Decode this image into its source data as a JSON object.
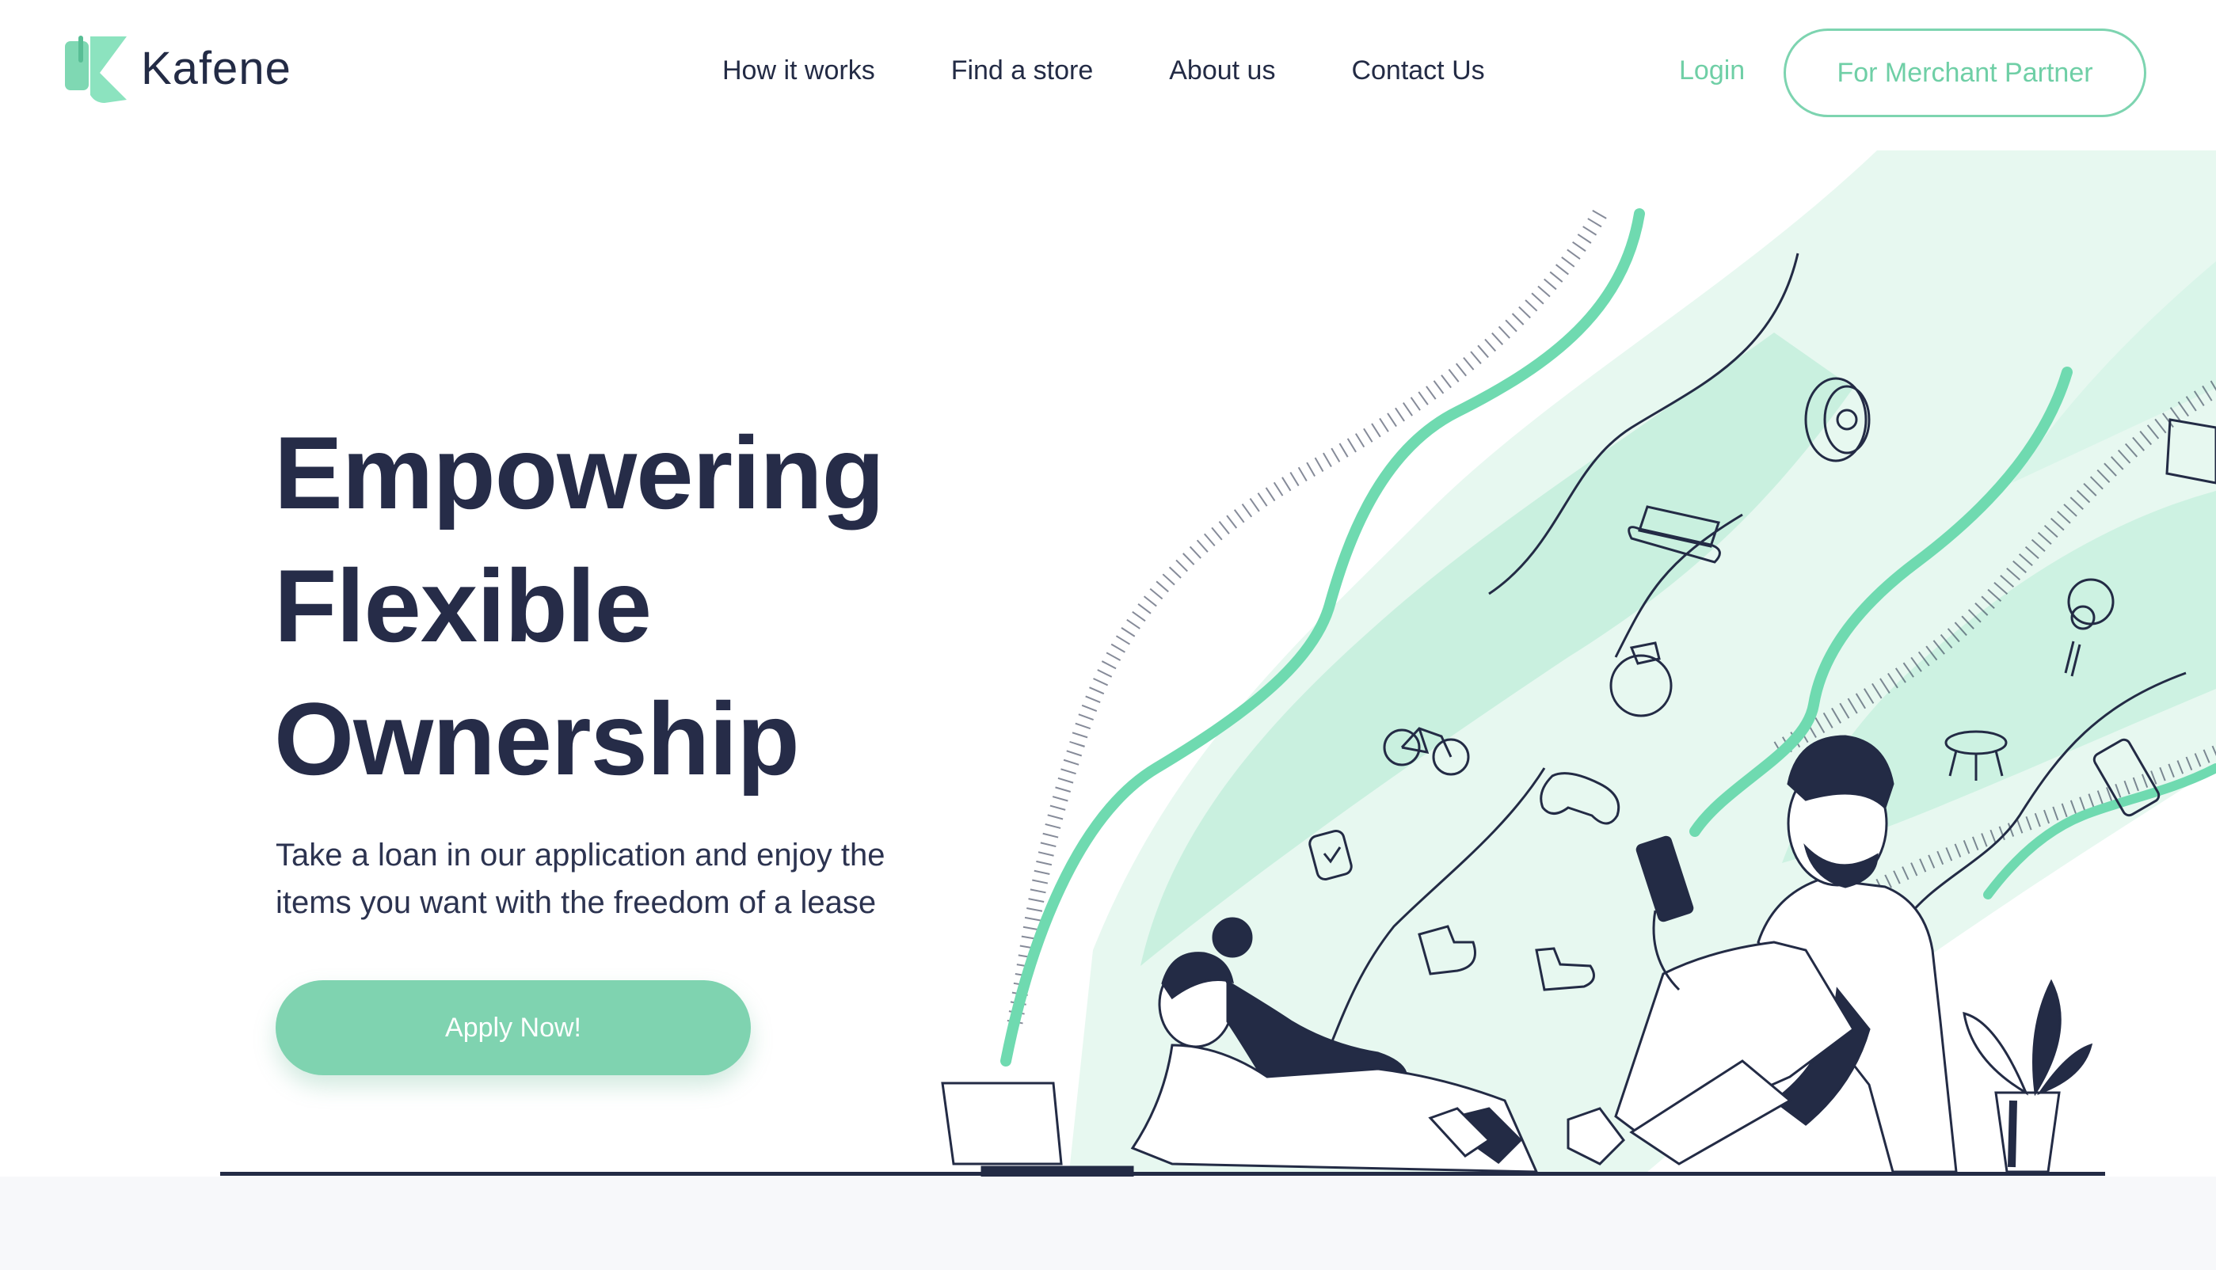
{
  "brand": {
    "name": "Kafene",
    "primary_color": "#7fd3b0",
    "text_color": "#262c48"
  },
  "nav": {
    "items": [
      {
        "label": "How it works"
      },
      {
        "label": "Find a store"
      },
      {
        "label": "About us"
      },
      {
        "label": "Contact Us"
      }
    ],
    "login_label": "Login",
    "merchant_label": "For Merchant Partner"
  },
  "hero": {
    "title_lines": [
      "Empowering",
      "Flexible",
      "Ownership"
    ],
    "subtitle_lines": [
      "Take a loan in our application and enjoy the",
      "items you want with the freedom of a lease"
    ],
    "cta_label": "Apply Now!"
  },
  "illustration": {
    "icons": [
      "tire-icon",
      "sofa-icon",
      "ring-icon",
      "bicycle-icon",
      "gamepad-icon",
      "watch-icon",
      "guitar-icon",
      "stool-icon",
      "phone-icon",
      "monitor-icon",
      "boot-icon",
      "sneaker-icon",
      "plant-icon",
      "laptop-icon"
    ]
  }
}
